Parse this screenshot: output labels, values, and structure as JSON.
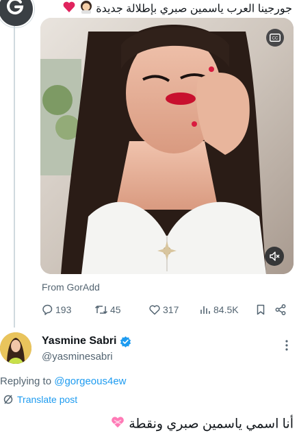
{
  "tweet": {
    "text": "جورجينا العرب ياسمين صبري بإطلالة جديدة",
    "emojis": [
      "woman-emoji",
      "red-heart-emoji"
    ],
    "media": {
      "cc_icon": "closed-captions-icon",
      "mute_icon": "speaker-muted-icon"
    },
    "source": "From GorAdd",
    "stats": {
      "replies": "193",
      "reposts": "45",
      "likes": "317",
      "views": "84.5K"
    }
  },
  "reply": {
    "name": "Yasmine Sabri",
    "handle": "@yasminesabri",
    "replying_prefix": "Replying to ",
    "replying_to": "@gorgeous4ew",
    "translate": "Translate post",
    "text": "أنا اسمي ياسمين صبري ونقطة",
    "emoji": "heart-with-ribbon-emoji"
  },
  "colors": {
    "accent": "#1d9bf0",
    "secondary_text": "#536471",
    "verified": "#1d9bf0",
    "lipstick": "#c8102e"
  }
}
